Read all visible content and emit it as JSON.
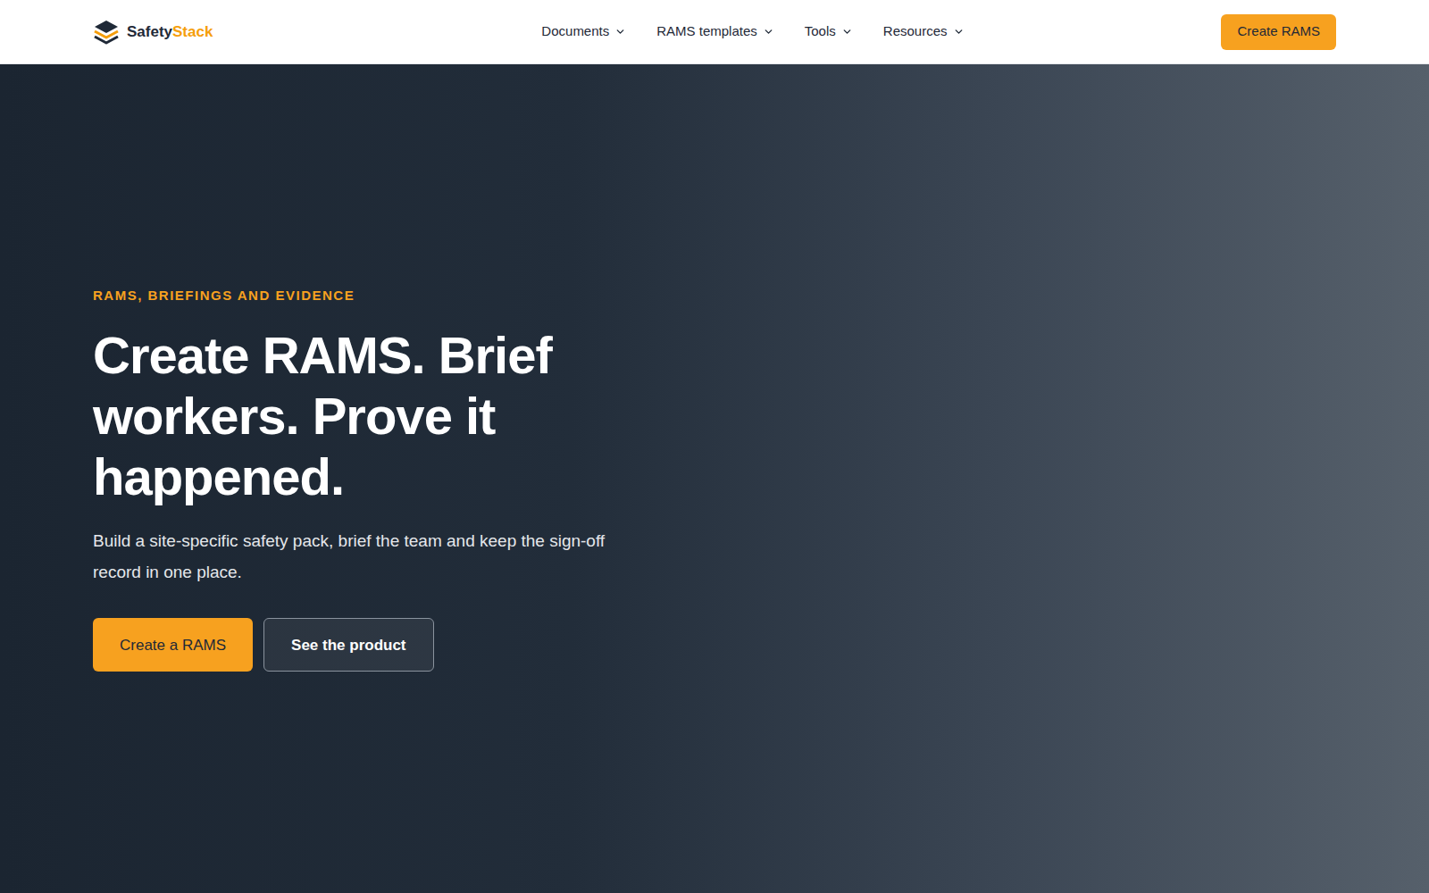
{
  "header": {
    "logo": {
      "part1": "Safety",
      "part2": "Stack"
    },
    "nav": [
      {
        "label": "Documents"
      },
      {
        "label": "RAMS templates"
      },
      {
        "label": "Tools"
      },
      {
        "label": "Resources"
      }
    ],
    "cta": "Create RAMS"
  },
  "hero": {
    "eyebrow": "RAMS, BRIEFINGS AND EVIDENCE",
    "title": "Create RAMS. Brief workers. Prove it happened.",
    "subtitle": "Build a site-specific safety pack, brief the team and keep the sign-off record in one place.",
    "primary_button": "Create a RAMS",
    "secondary_button": "See the product"
  }
}
